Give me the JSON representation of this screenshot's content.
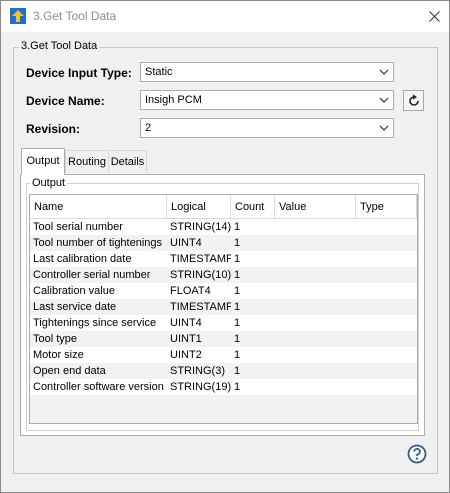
{
  "window": {
    "title": "3.Get Tool Data",
    "close_icon": "close-icon",
    "app_icon": "app-arrow-icon"
  },
  "group": {
    "legend": "3.Get Tool Data"
  },
  "fields": {
    "device_input_type": {
      "label": "Device Input Type:",
      "value": "Static"
    },
    "device_name": {
      "label": "Device Name:",
      "value": "Insigh PCM"
    },
    "revision": {
      "label": "Revision:",
      "value": "2"
    }
  },
  "tabs": [
    {
      "label": "Output",
      "active": true
    },
    {
      "label": "Routing",
      "active": false
    },
    {
      "label": "Details",
      "active": false
    }
  ],
  "output": {
    "legend": "Output",
    "columns": [
      "Name",
      "Logical",
      "Count",
      "Value",
      "Type"
    ],
    "rows": [
      [
        "Tool serial number",
        "STRING(14)",
        "1",
        "",
        ""
      ],
      [
        "Tool number of tightenings",
        "UINT4",
        "1",
        "",
        ""
      ],
      [
        "Last calibration date",
        "TIMESTAMP",
        "1",
        "",
        ""
      ],
      [
        "Controller serial number",
        "STRING(10)",
        "1",
        "",
        ""
      ],
      [
        "Calibration value",
        "FLOAT4",
        "1",
        "",
        ""
      ],
      [
        "Last service date",
        "TIMESTAMP",
        "1",
        "",
        ""
      ],
      [
        "Tightenings since service",
        "UINT4",
        "1",
        "",
        ""
      ],
      [
        "Tool type",
        "UINT1",
        "1",
        "",
        ""
      ],
      [
        "Motor size",
        "UINT2",
        "1",
        "",
        ""
      ],
      [
        "Open end data",
        "STRING(3)",
        "1",
        "",
        ""
      ],
      [
        "Controller software version",
        "STRING(19)",
        "1",
        "",
        ""
      ]
    ]
  },
  "colors": {
    "accent_blue": "#1f6fd1",
    "icon_yellow": "#f2c12e",
    "help_blue": "#2f5c8a"
  }
}
